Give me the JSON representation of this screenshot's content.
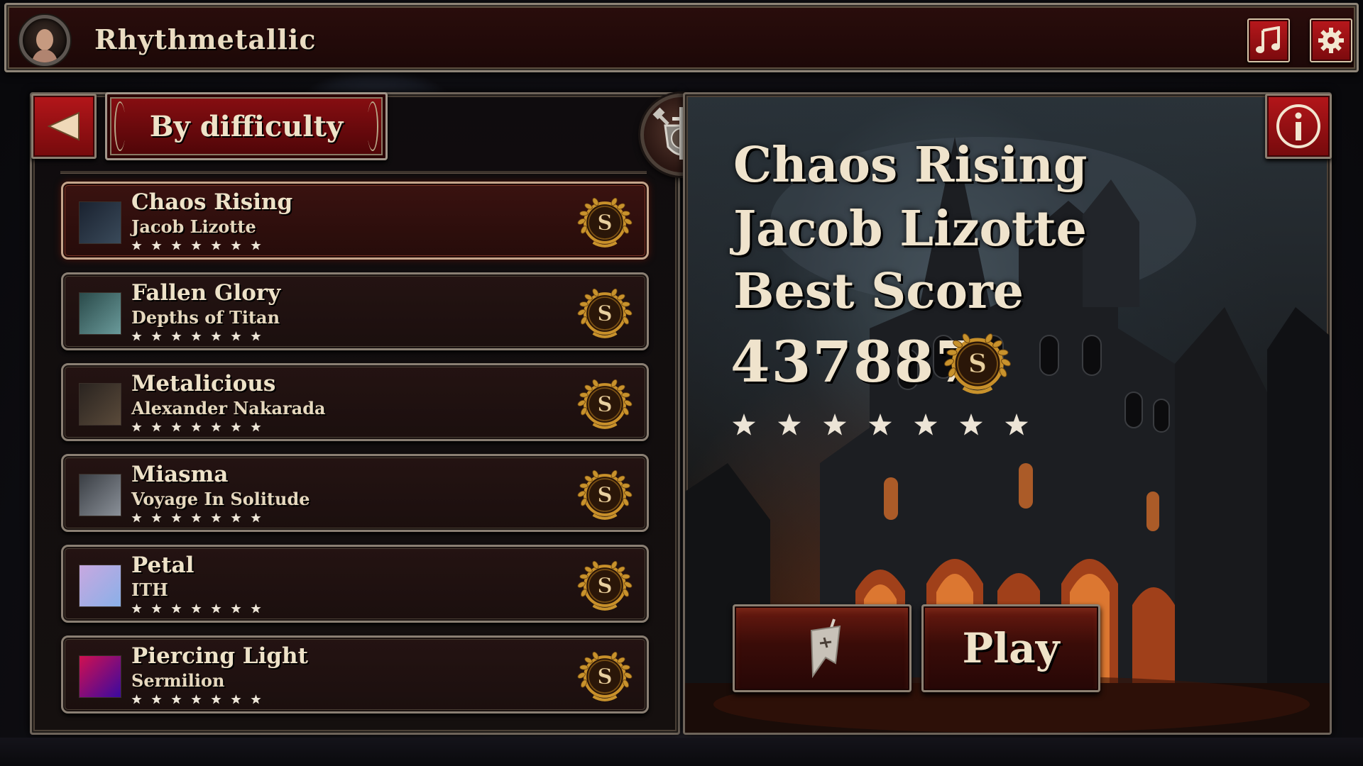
{
  "app": {
    "title": "Rhythmetallic"
  },
  "toolbar": {
    "music_icon": "music-note-icon",
    "settings_icon": "gear-icon",
    "accent_color": "#b3161a"
  },
  "song_select": {
    "filter_label": "By difficulty",
    "back_icon": "triangle-left-icon",
    "selected_index": 0,
    "songs": [
      {
        "title": "Chaos Rising",
        "artist": "Jacob Lizotte",
        "rank": "S",
        "stars": 7,
        "thumb_colors": [
          "#1a2230",
          "#3a4a5a"
        ]
      },
      {
        "title": "Fallen Glory",
        "artist": "Depths of Titan",
        "rank": "S",
        "stars": 7,
        "thumb_colors": [
          "#2a4a4a",
          "#6a9a9a"
        ]
      },
      {
        "title": "Metalicious",
        "artist": "Alexander Nakarada",
        "rank": "S",
        "stars": 7,
        "thumb_colors": [
          "#2a2420",
          "#5a4a3a"
        ]
      },
      {
        "title": "Miasma",
        "artist": "Voyage In Solitude",
        "rank": "S",
        "stars": 7,
        "thumb_colors": [
          "#3a3e44",
          "#8a9098"
        ]
      },
      {
        "title": "Petal",
        "artist": "ITH",
        "rank": "S",
        "stars": 7,
        "thumb_colors": [
          "#c8a8e0",
          "#8ab0e8"
        ]
      },
      {
        "title": "Piercing Light",
        "artist": "Sermilion",
        "rank": "S",
        "stars": 7,
        "thumb_colors": [
          "#d01050",
          "#3a0aa0"
        ]
      }
    ]
  },
  "detail": {
    "title": "Chaos Rising",
    "artist": "Jacob Lizotte",
    "best_score_label": "Best Score",
    "best_score": "437887",
    "rank": "S",
    "stars": 7,
    "info_icon": "info-icon",
    "banner_icon": "banner-flag-icon",
    "play_label": "Play"
  }
}
